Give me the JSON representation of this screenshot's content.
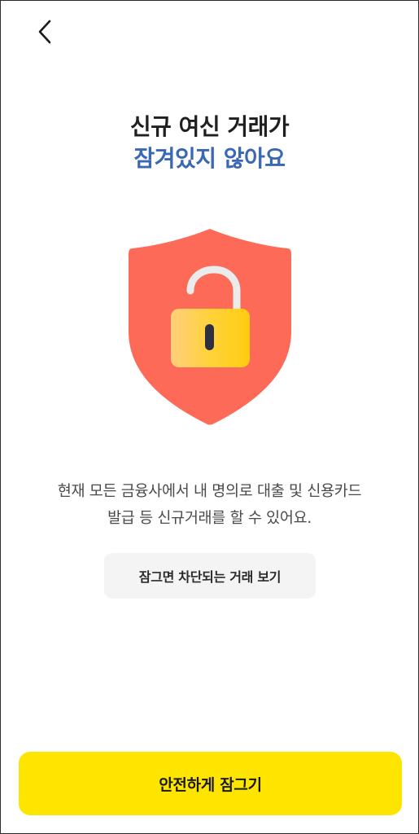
{
  "header": {
    "back_icon": "chevron-left-icon"
  },
  "title": {
    "line1": "신규 여신 거래가",
    "line2": "잠겨있지 않아요",
    "line2_color": "#3a68b5"
  },
  "illustration": {
    "icon": "unlocked-shield-icon",
    "shield_color": "#fd6a57",
    "lock_color": "#ffd21e"
  },
  "description": {
    "line1": "현재 모든 금융사에서 내 명의로 대출 및 신용카드",
    "line2": "발급 등 신규거래를 할 수 있어요."
  },
  "buttons": {
    "view_blocked_label": "잠그면 차단되는 거래 보기",
    "lock_label": "안전하게 잠그기",
    "lock_color": "#fee500"
  }
}
